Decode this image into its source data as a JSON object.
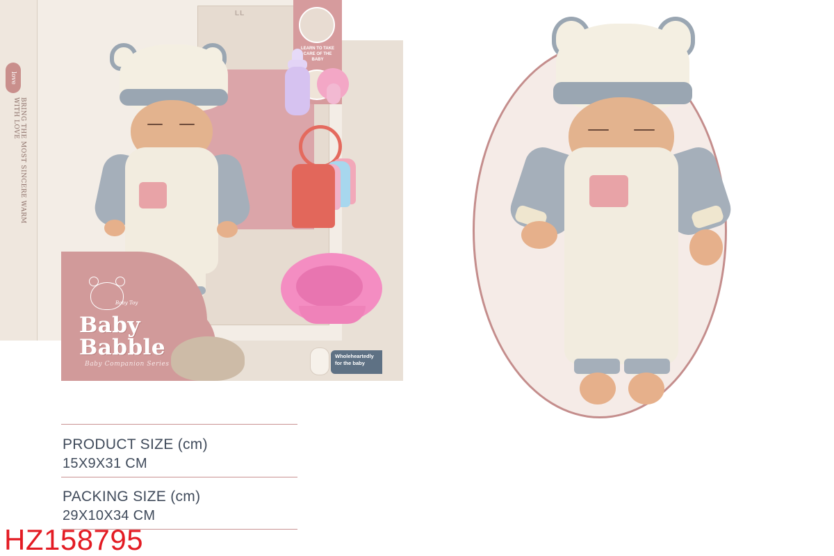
{
  "box": {
    "side_text": "BRING THE MOST SINCERE WARM WITH LOVE",
    "love_badge": "love",
    "card_corner_text": "LL",
    "info_text": "LEARN TO TAKE CARE OF THE BABY",
    "brand_title_line1": "Baby",
    "brand_title_line2": "Babble",
    "brand_subtitle": "Baby Companion Series",
    "brand_signature": "Baby Toy",
    "tag_text": "Wholeheartedly for the baby"
  },
  "specs": {
    "product_size_label": "PRODUCT SIZE (cm)",
    "product_size_value": "15X9X31 CM",
    "packing_size_label": "PACKING SIZE (cm)",
    "packing_size_value": "29X10X34 CM"
  },
  "item_code": "HZ158795",
  "colors": {
    "accent_pink": "#d19a9a",
    "item_code_red": "#e31b23",
    "spec_text": "#3f4a5a",
    "oval_border": "#c48d8c"
  }
}
